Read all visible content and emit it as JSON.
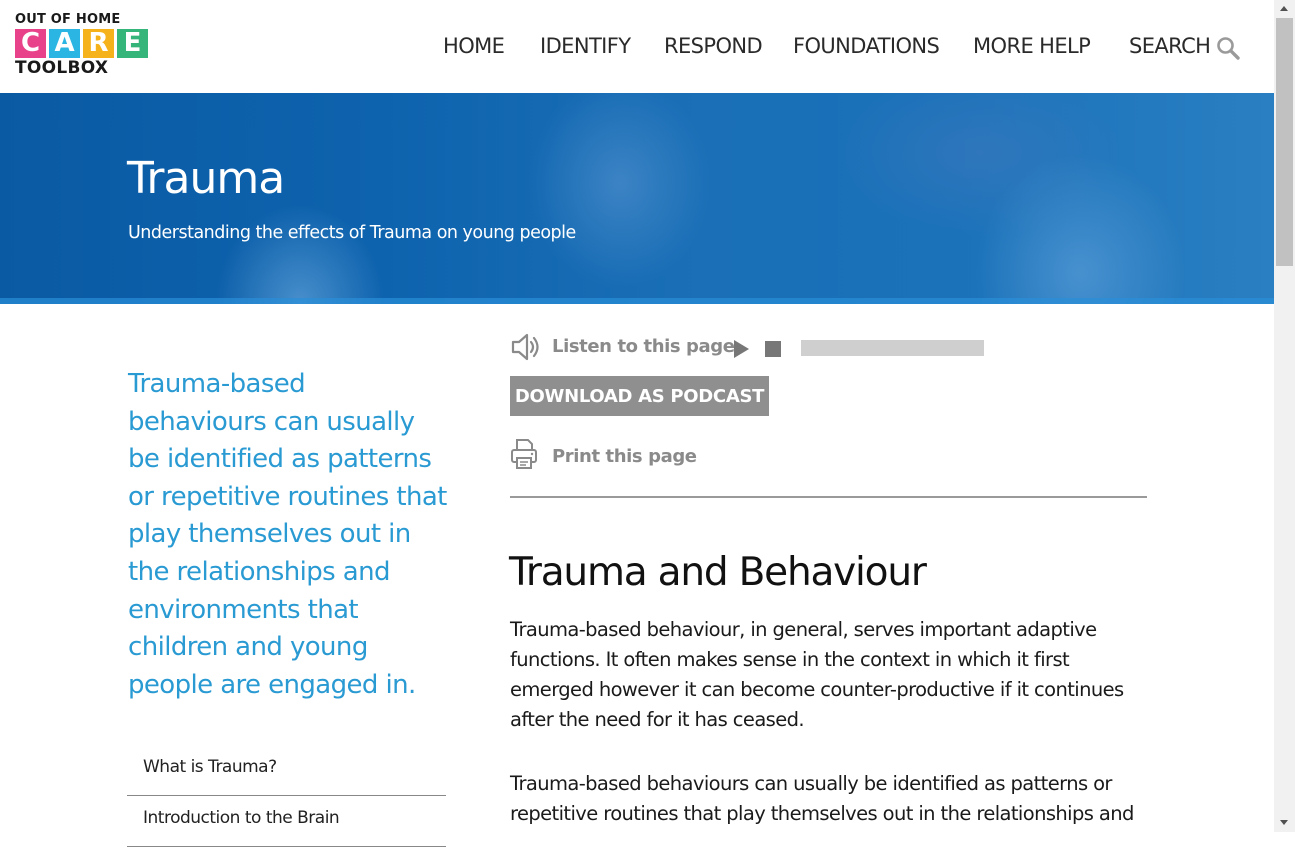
{
  "brand": {
    "logo_top": "OUT OF HOME",
    "logo_care_letters": [
      "C",
      "A",
      "R",
      "E"
    ],
    "logo_care_colors": [
      "#e8428a",
      "#2bb5e3",
      "#f6b21a",
      "#36b57a"
    ],
    "logo_bottom": "TOOLBOX"
  },
  "nav": {
    "items": [
      {
        "label": "HOME"
      },
      {
        "label": "IDENTIFY"
      },
      {
        "label": "RESPOND"
      },
      {
        "label": "FOUNDATIONS"
      },
      {
        "label": "MORE HELP"
      }
    ],
    "search_label": "SEARCH",
    "search_icon": "magnifier-icon"
  },
  "hero": {
    "title": "Trauma",
    "subtitle": "Understanding the effects of Trauma on young people"
  },
  "sidebar": {
    "pullquote": "Trauma-based behaviours can usually be identified as patterns or repetitive routines that play themselves out in the relationships and environments that children and young people are engaged in.",
    "nav": [
      {
        "label": "What is Trauma?"
      },
      {
        "label": "Introduction to the Brain"
      }
    ]
  },
  "tools": {
    "listen_label": "Listen to this page",
    "listen_icon": "speaker-icon",
    "play_icon": "play-icon",
    "stop_icon": "stop-icon",
    "progress": 0,
    "podcast_label": "DOWNLOAD AS PODCAST",
    "print_label": "Print this page",
    "print_icon": "printer-icon"
  },
  "article": {
    "title": "Trauma and Behaviour",
    "paragraphs": [
      "Trauma-based behaviour, in general, serves important adaptive functions.  It often makes sense in the context in which it first emerged however it can become counter-productive if it continues after the need for it has ceased.",
      "Trauma-based behaviours can usually be identified as patterns or repetitive routines that play themselves out in the relationships and"
    ]
  },
  "colors": {
    "accent": "#2a9ad3",
    "hero_blue": "#0e63ae",
    "tool_grey": "#8a8a8a"
  }
}
